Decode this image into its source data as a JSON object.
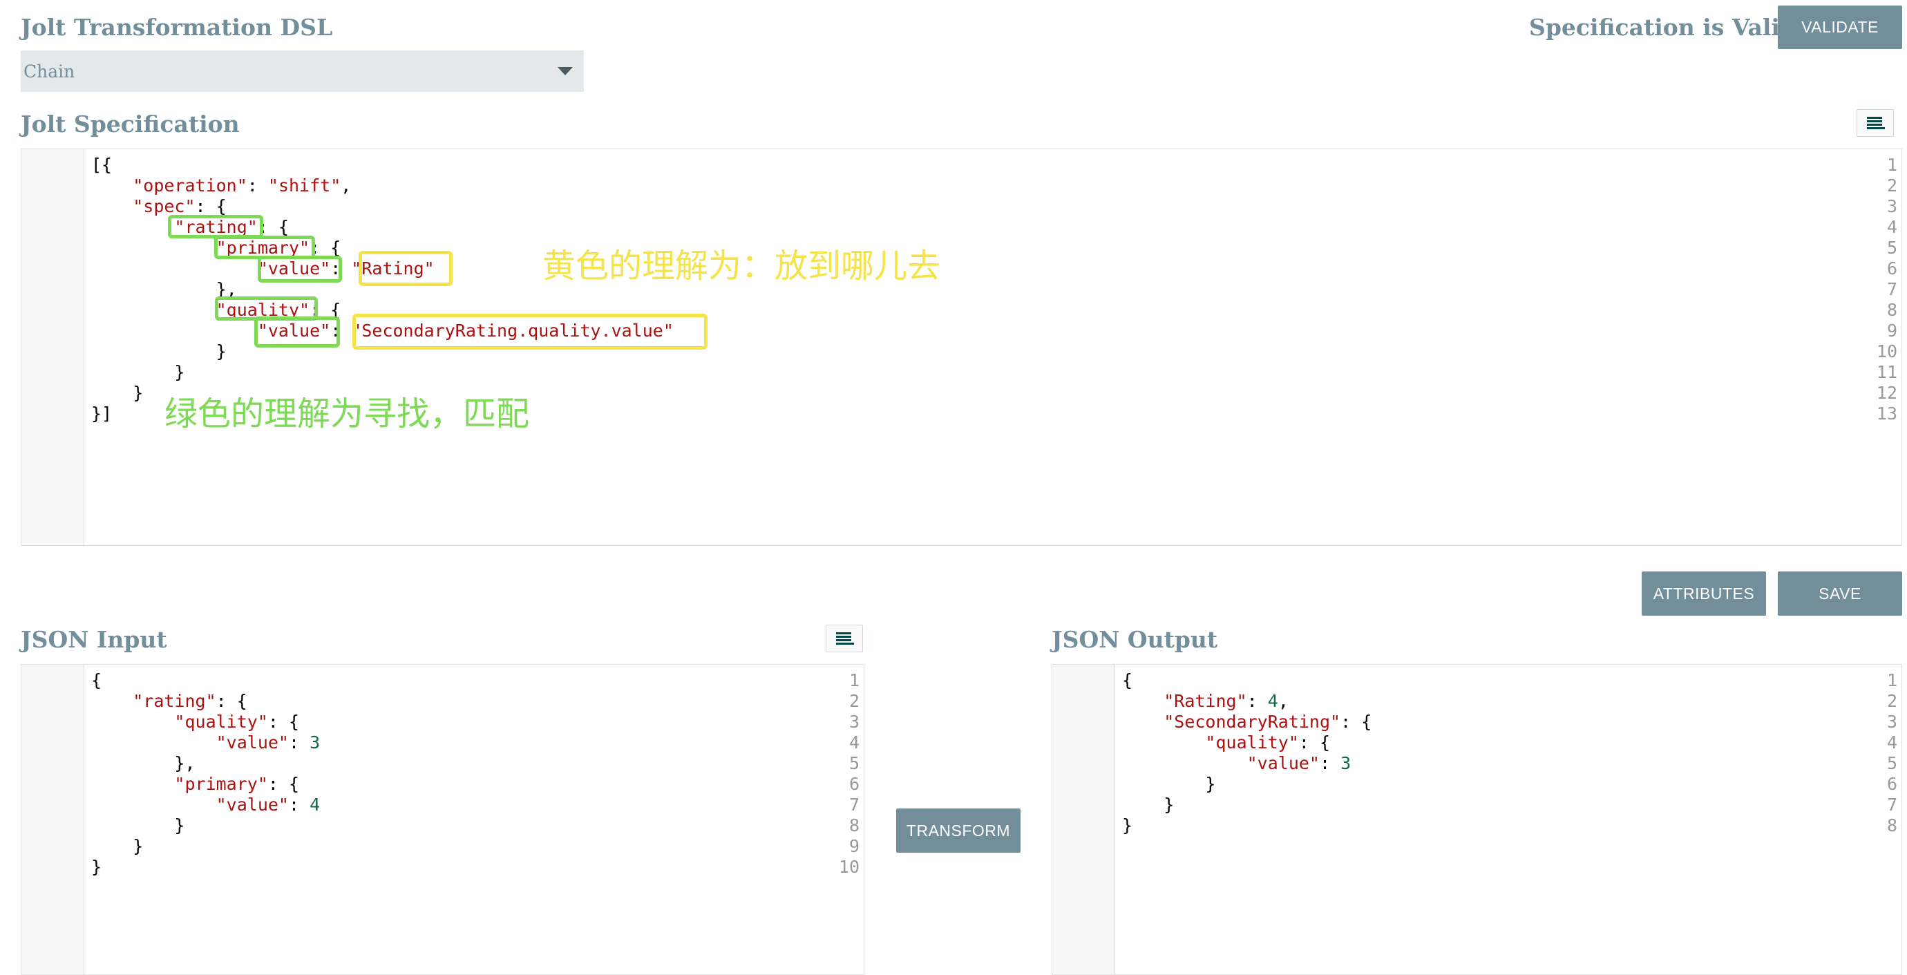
{
  "header": {
    "title": "Jolt Transformation DSL",
    "status": "Specification is Valid",
    "validate_label": "VALIDATE"
  },
  "dsl_select": {
    "value": "Chain"
  },
  "spec": {
    "title": "Jolt Specification",
    "lines": [
      "[{",
      "    \"operation\": \"shift\",",
      "    \"spec\": {",
      "        \"rating\": {",
      "            \"primary\": {",
      "                \"value\": \"Rating\"",
      "            },",
      "            \"quality\": {",
      "                \"value\": \"SecondaryRating.quality.value\"",
      "            }",
      "        }",
      "    }",
      "}]"
    ]
  },
  "annotations": {
    "yellow_note": "黄色的理解为：放到哪儿去",
    "green_note": "绿色的理解为寻找，匹配",
    "yellow_color": "#f5e34a",
    "green_color": "#7ed957"
  },
  "actions": {
    "attributes_label": "ATTRIBUTES",
    "save_label": "SAVE",
    "transform_label": "TRANSFORM"
  },
  "input": {
    "title": "JSON Input",
    "lines": [
      "{",
      "    \"rating\": {",
      "        \"quality\": {",
      "            \"value\": 3",
      "        },",
      "        \"primary\": {",
      "            \"value\": 4",
      "        }",
      "    }",
      "}"
    ]
  },
  "output": {
    "title": "JSON Output",
    "lines": [
      "{",
      "    \"Rating\": 4,",
      "    \"SecondaryRating\": {",
      "        \"quality\": {",
      "            \"value\": 3",
      "        }",
      "    }",
      "}"
    ]
  },
  "colors": {
    "accent": "#728e9b",
    "string": "#aa1111",
    "number": "#116644"
  },
  "icons": {
    "format": "align-left-icon",
    "dropdown": "chevron-down-icon"
  }
}
